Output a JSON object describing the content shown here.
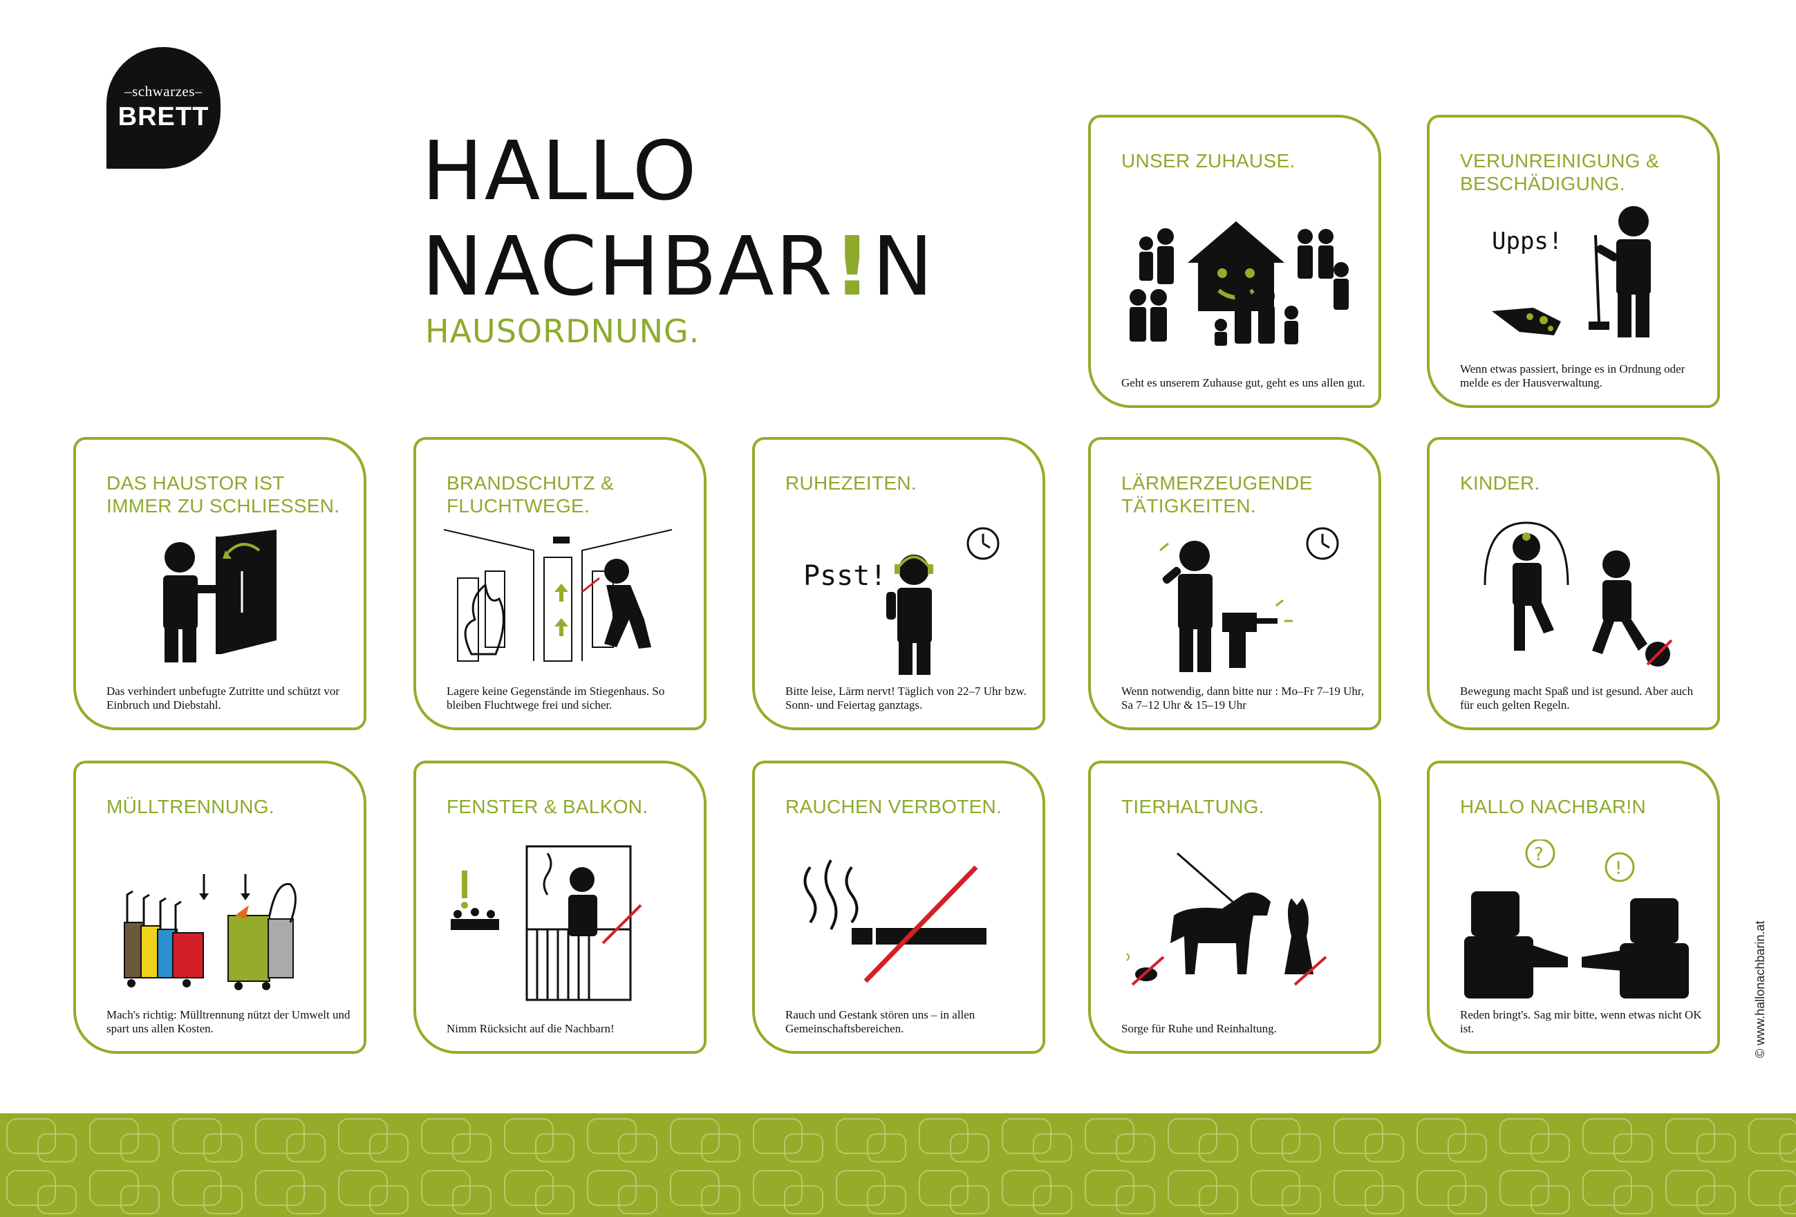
{
  "logo": {
    "top_text": "–schwarzes–",
    "main_text": "BRETT"
  },
  "headline": {
    "line1": "HALLO",
    "line2_pre": "NACHBAR",
    "line2_bang": "!",
    "line2_post": "N"
  },
  "subtitle": "HAUSORDNUNG.",
  "colors": {
    "accent": "#95ac2a",
    "text": "#111111",
    "red": "#d32027",
    "background": "#ffffff"
  },
  "cards": [
    {
      "title": "UNSER ZUHAUSE.",
      "text": "Geht es unserem Zuhause gut, geht es uns allen gut.",
      "icon": "house-family-icon"
    },
    {
      "title": "VERUNREINIGUNG & BESCHÄDIGUNG.",
      "text": "Wenn etwas passiert, bringe es in Ordnung oder melde es der Hausverwaltung.",
      "icon": "sweeping-person-icon",
      "label": "Upps!"
    },
    {
      "title": "DAS HAUSTOR IST IMMER ZU SCHLIESSEN.",
      "text": "Das verhindert unbefugte Zutritte und schützt vor Einbruch und Diebstahl.",
      "icon": "closing-door-icon"
    },
    {
      "title": "BRANDSCHUTZ & FLUCHTWEGE.",
      "text": "Lagere keine Gegenstände im Stiegenhaus. So bleiben Fluchtwege frei und sicher.",
      "icon": "fire-escape-icon"
    },
    {
      "title": "RUHEZEITEN.",
      "text": "Bitte leise, Lärm nervt! Täglich von 22–7 Uhr bzw. Sonn- und Feiertag ganztags.",
      "icon": "quiet-person-icon",
      "label": "Psst!"
    },
    {
      "title": "LÄRMERZEUGENDE TÄTIGKEITEN.",
      "text": "Wenn notwendig, dann bitte nur : Mo–Fr 7–19 Uhr, Sa 7–12 Uhr & 15–19 Uhr",
      "icon": "drilling-person-icon"
    },
    {
      "title": "KINDER.",
      "text": "Bewegung macht Spaß und ist gesund. Aber auch für euch gelten Regeln.",
      "icon": "playing-children-icon"
    },
    {
      "title": "MÜLLTRENNUNG.",
      "text": "Mach's richtig: Mülltrennung nützt der Umwelt und spart uns allen Kosten.",
      "icon": "waste-bins-icon"
    },
    {
      "title": "FENSTER & BALKON.",
      "text": "Nimm Rücksicht auf die Nachbarn!",
      "icon": "balcony-icon"
    },
    {
      "title": "RAUCHEN VERBOTEN.",
      "text": "Rauch und Gestank stören uns – in allen Gemeinschaftsbereichen.",
      "icon": "no-smoking-icon"
    },
    {
      "title": "TIERHALTUNG.",
      "text": "Sorge für Ruhe und Reinhaltung.",
      "icon": "dog-cat-icon"
    },
    {
      "title": "HALLO NACHBAR!N",
      "text": "Reden bringt's. Sag mir bitte, wenn etwas nicht OK ist.",
      "icon": "handshake-icon"
    }
  ],
  "credit": "© www.hallonachbarin.at"
}
